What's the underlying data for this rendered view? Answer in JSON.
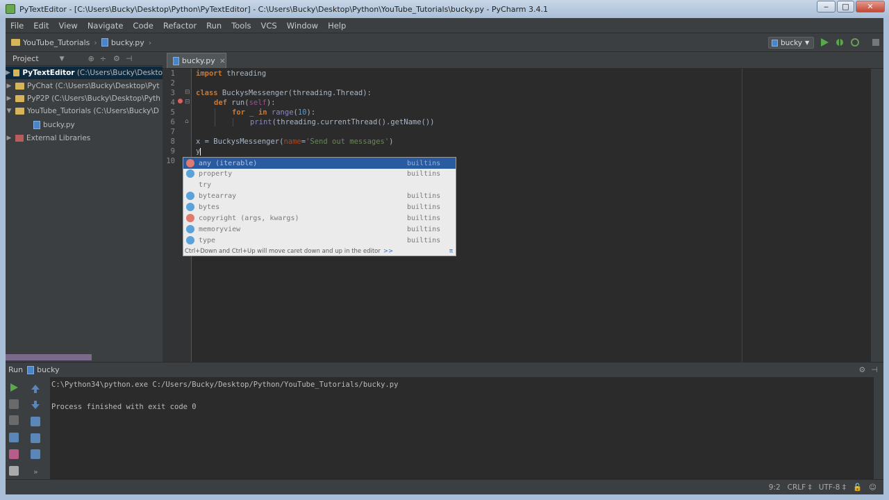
{
  "window": {
    "title": "PyTextEditor - [C:\\Users\\Bucky\\Desktop\\Python\\PyTextEditor] - C:\\Users\\Bucky\\Desktop\\Python\\YouTube_Tutorials\\bucky.py - PyCharm 3.4.1",
    "min_label": "‒",
    "max_label": "□",
    "close_label": "✕"
  },
  "menu": [
    "File",
    "Edit",
    "View",
    "Navigate",
    "Code",
    "Refactor",
    "Run",
    "Tools",
    "VCS",
    "Window",
    "Help"
  ],
  "navbar": {
    "crumbs": [
      "YouTube_Tutorials",
      "bucky.py"
    ],
    "run_config": "bucky"
  },
  "project": {
    "header": "Project",
    "items": [
      {
        "label": "PyTextEditor",
        "path": "(C:\\Users\\Bucky\\Deskto",
        "selected": true
      },
      {
        "label": "PyChat",
        "path": "(C:\\Users\\Bucky\\Desktop\\Pyt",
        "selected": false
      },
      {
        "label": "PyP2P",
        "path": "(C:\\Users\\Bucky\\Desktop\\Pyth",
        "selected": false
      },
      {
        "label": "YouTube_Tutorials",
        "path": "(C:\\Users\\Bucky\\D",
        "selected": false
      },
      {
        "label": "bucky.py",
        "path": "",
        "selected": false
      },
      {
        "label": "External Libraries",
        "path": "",
        "selected": false
      }
    ]
  },
  "editor": {
    "tab": "bucky.py",
    "line_numbers": [
      "1",
      "2",
      "3",
      "4",
      "5",
      "6",
      "7",
      "8",
      "9",
      "10"
    ],
    "lines": {
      "l1_kw": "import",
      "l1_rest": " threading",
      "l3_kw": "class",
      "l3_rest": " BuckysMessenger(threading.Thread):",
      "l4_kw": "def",
      "l4_name": " run(",
      "l4_self": "self",
      "l4_end": "):",
      "l5_kw": "for",
      "l5_mid": " _ ",
      "l5_in": "in",
      "l5_range": " range",
      "l5_open": "(",
      "l5_num": "10",
      "l5_end": "):",
      "l6_print": "print",
      "l6_rest": "(threading.currentThread().getName())",
      "l8_pre": "x = BuckysMessenger(",
      "l8_param": "name",
      "l8_eq": "=",
      "l8_str": "'Send out messages'",
      "l8_end": ")",
      "l9": "y"
    }
  },
  "completion": {
    "items": [
      {
        "name": "any (iterable)",
        "type": "builtins",
        "icon": "function",
        "selected": true
      },
      {
        "name": "property",
        "type": "builtins",
        "icon": "class",
        "selected": false
      },
      {
        "name": "try",
        "type": "",
        "icon": "none",
        "selected": false
      },
      {
        "name": "bytearray",
        "type": "builtins",
        "icon": "class",
        "selected": false
      },
      {
        "name": "bytes",
        "type": "builtins",
        "icon": "class",
        "selected": false
      },
      {
        "name": "copyright (args, kwargs)",
        "type": "builtins",
        "icon": "function",
        "selected": false
      },
      {
        "name": "memoryview",
        "type": "builtins",
        "icon": "class",
        "selected": false
      },
      {
        "name": "type",
        "type": "builtins",
        "icon": "class",
        "selected": false
      }
    ],
    "footer": "Ctrl+Down and Ctrl+Up will move caret down and up in the editor",
    "footer_link": ">>",
    "footer_pi": "π"
  },
  "run": {
    "header": "Run",
    "config": "bucky",
    "console": [
      "C:\\Python34\\python.exe C:/Users/Bucky/Desktop/Python/YouTube_Tutorials/bucky.py",
      "",
      "Process finished with exit code 0"
    ]
  },
  "status": {
    "position": "9:2",
    "line_sep": "CRLF ‡",
    "encoding": "UTF-8 ‡"
  },
  "colors": {
    "background": "#3c3f41",
    "editor_bg": "#2b2b2b",
    "keyword": "#cc7832",
    "string": "#6a8759",
    "number": "#6897bb",
    "selection": "#0d293e",
    "popup_selected": "#2a5aa0"
  }
}
